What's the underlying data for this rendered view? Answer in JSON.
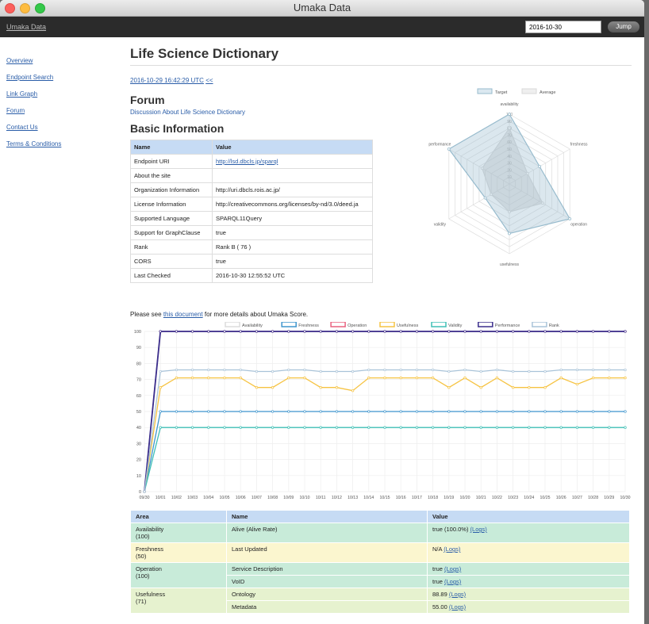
{
  "window": {
    "title": "Umaka Data"
  },
  "navbar": {
    "brand": "Umaka Data",
    "date_value": "2016-10-30",
    "jump_label": "Jump"
  },
  "sidebar": {
    "items": [
      {
        "label": "Overview"
      },
      {
        "label": "Endpoint Search"
      },
      {
        "label": "Link Graph"
      },
      {
        "label": "Forum"
      },
      {
        "label": "Contact Us"
      },
      {
        "label": "Terms & Conditions"
      }
    ]
  },
  "main": {
    "title": "Life Science Dictionary",
    "timestamp": "2016-10-29 16:42:29 UTC",
    "prev_link": "<<",
    "forum_heading": "Forum",
    "forum_link": "Discussion About Life Science Dictionary",
    "basic_heading": "Basic Information",
    "info_headers": [
      "Name",
      "Value"
    ],
    "info_rows": [
      {
        "name": "Endpoint URI",
        "value": "http://lsd.dbcls.jp/sparql"
      },
      {
        "name": "About the site",
        "value": ""
      },
      {
        "name": "Organization Information",
        "value": "http://uri.dbcls.rois.ac.jp/"
      },
      {
        "name": "License Information",
        "value": "http://creativecommons.org/licenses/by-nd/3.0/deed.ja"
      },
      {
        "name": "Supported Language",
        "value": "SPARQL11Query"
      },
      {
        "name": "Support for GraphClause",
        "value": "true"
      },
      {
        "name": "Rank",
        "value": "Rank B ( 76 )"
      },
      {
        "name": "CORS",
        "value": "true"
      },
      {
        "name": "Last Checked",
        "value": "2016-10-30 12:55:52 UTC"
      }
    ],
    "see_prefix": "Please see",
    "see_link": "this document",
    "see_suffix": "for more details about Umaka Score.",
    "score_headers": [
      "Area",
      "Name",
      "Value"
    ],
    "score_rows": [
      {
        "area": "Availability\n(100)",
        "items": [
          {
            "name": "Alive (Alive Rate)",
            "value": "true (100.0%)",
            "link": "(Logs)"
          }
        ],
        "color": "#c8ebd9"
      },
      {
        "area": "Freshness\n(50)",
        "items": [
          {
            "name": "Last Updated",
            "value": "N/A",
            "link": "(Logs)"
          }
        ],
        "color": "#fbf6cf"
      },
      {
        "area": "Operation\n(100)",
        "items": [
          {
            "name": "Service Description",
            "value": "true",
            "link": "(Logs)"
          },
          {
            "name": "VoID",
            "value": "true",
            "link": "(Logs)"
          }
        ],
        "color": "#c8ebd9"
      },
      {
        "area": "Usefulness\n(71)",
        "items": [
          {
            "name": "Ontology",
            "value": "88.89",
            "link": "(Logs)"
          },
          {
            "name": "Metadata",
            "value": "55.00",
            "link": "(Logs)"
          }
        ],
        "color": "#e6f2cf"
      }
    ]
  },
  "chart_data": [
    {
      "type": "radar",
      "legend": [
        "Target",
        "Average"
      ],
      "legend_colors": [
        "#97bbcd",
        "#d8d8d8"
      ],
      "axes": [
        "availability",
        "freshness",
        "operation",
        "usefulness",
        "validity",
        "performance"
      ],
      "scale": [
        0,
        100
      ],
      "ticks": [
        10,
        20,
        30,
        40,
        50,
        60,
        70,
        80,
        90,
        100
      ],
      "series": [
        {
          "name": "Target",
          "values": [
            100,
            50,
            100,
            71,
            40,
            100
          ]
        },
        {
          "name": "Average",
          "values": [
            80,
            30,
            55,
            40,
            30,
            45
          ]
        }
      ]
    },
    {
      "type": "line",
      "x": [
        "09/30",
        "10/01",
        "10/02",
        "10/03",
        "10/04",
        "10/05",
        "10/06",
        "10/07",
        "10/08",
        "10/09",
        "10/10",
        "10/11",
        "10/12",
        "10/13",
        "10/14",
        "10/15",
        "10/16",
        "10/17",
        "10/18",
        "10/19",
        "10/20",
        "10/21",
        "10/22",
        "10/23",
        "10/24",
        "10/25",
        "10/26",
        "10/27",
        "10/28",
        "10/29",
        "10/30"
      ],
      "ylim": [
        0,
        100
      ],
      "yticks": [
        0,
        10,
        20,
        30,
        40,
        50,
        60,
        70,
        80,
        90,
        100
      ],
      "series": [
        {
          "name": "Availability",
          "color": "#dcdcdc",
          "values": [
            0,
            100,
            100,
            100,
            100,
            100,
            100,
            100,
            100,
            100,
            100,
            100,
            100,
            100,
            100,
            100,
            100,
            100,
            100,
            100,
            100,
            100,
            100,
            100,
            100,
            100,
            100,
            100,
            100,
            100,
            100
          ]
        },
        {
          "name": "Freshness",
          "color": "#3e95cd",
          "values": [
            0,
            50,
            50,
            50,
            50,
            50,
            50,
            50,
            50,
            50,
            50,
            50,
            50,
            50,
            50,
            50,
            50,
            50,
            50,
            50,
            50,
            50,
            50,
            50,
            50,
            50,
            50,
            50,
            50,
            50,
            50
          ]
        },
        {
          "name": "Operation",
          "color": "#e8607e",
          "values": [
            0,
            100,
            100,
            100,
            100,
            100,
            100,
            100,
            100,
            100,
            100,
            100,
            100,
            100,
            100,
            100,
            100,
            100,
            100,
            100,
            100,
            100,
            100,
            100,
            100,
            100,
            100,
            100,
            100,
            100,
            100
          ]
        },
        {
          "name": "Usefulness",
          "color": "#f6c342",
          "values": [
            0,
            65,
            71,
            71,
            71,
            71,
            71,
            65,
            65,
            71,
            71,
            65,
            65,
            63,
            71,
            71,
            71,
            71,
            71,
            65,
            71,
            65,
            71,
            65,
            65,
            65,
            71,
            67,
            71,
            71,
            71
          ]
        },
        {
          "name": "Validity",
          "color": "#3fbfb5",
          "values": [
            0,
            40,
            40,
            40,
            40,
            40,
            40,
            40,
            40,
            40,
            40,
            40,
            40,
            40,
            40,
            40,
            40,
            40,
            40,
            40,
            40,
            40,
            40,
            40,
            40,
            40,
            40,
            40,
            40,
            40,
            40
          ]
        },
        {
          "name": "Performance",
          "color": "#3a2d8c",
          "values": [
            0,
            100,
            100,
            100,
            100,
            100,
            100,
            100,
            100,
            100,
            100,
            100,
            100,
            100,
            100,
            100,
            100,
            100,
            100,
            100,
            100,
            100,
            100,
            100,
            100,
            100,
            100,
            100,
            100,
            100,
            100
          ]
        },
        {
          "name": "Rank",
          "color": "#a9c3d8",
          "values": [
            0,
            75,
            76,
            76,
            76,
            76,
            76,
            75,
            75,
            76,
            76,
            75,
            75,
            75,
            76,
            76,
            76,
            76,
            76,
            75,
            76,
            75,
            76,
            75,
            75,
            75,
            76,
            76,
            76,
            76,
            76
          ]
        }
      ]
    }
  ]
}
